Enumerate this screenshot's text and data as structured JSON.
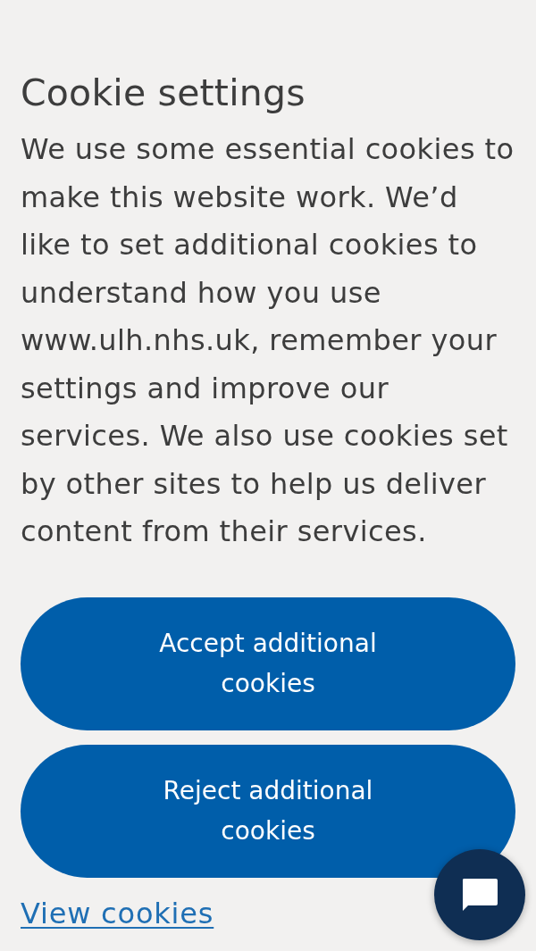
{
  "cookie_banner": {
    "title": "Cookie settings",
    "body": "We use some essential cookies to make this website work. We’d like to set additional cookies to understand how you use www.ulh.nhs.uk, remember your settings and improve our services. We also use cookies set by other sites to help us deliver content from their services.",
    "buttons": [
      {
        "label": "Accept additional cookies"
      },
      {
        "label": "Reject additional cookies"
      }
    ],
    "link": "View cookies"
  }
}
